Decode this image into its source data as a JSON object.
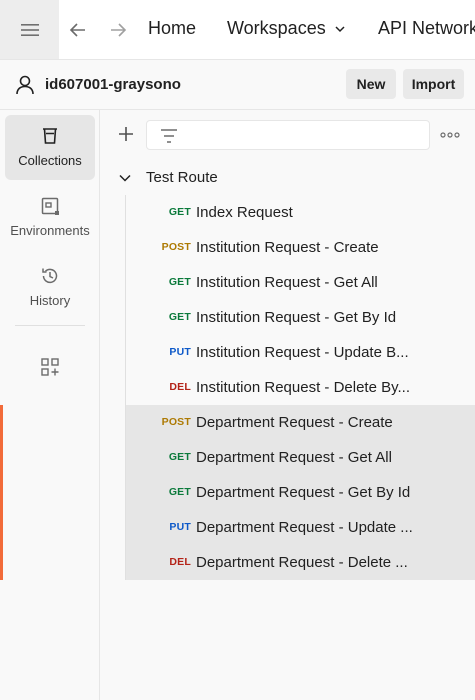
{
  "topbar": {
    "home_label": "Home",
    "workspaces_label": "Workspaces",
    "api_network_label": "API Network"
  },
  "workspace": {
    "name": "id607001-graysono",
    "new_label": "New",
    "import_label": "Import"
  },
  "rail": {
    "items": [
      {
        "label": "Collections",
        "icon": "collections-icon",
        "active": true
      },
      {
        "label": "Environments",
        "icon": "environments-icon",
        "active": false
      },
      {
        "label": "History",
        "icon": "history-icon",
        "active": false
      }
    ]
  },
  "filter": {
    "placeholder": ""
  },
  "collection": {
    "name": "Test Route",
    "requests": [
      {
        "method": "GET",
        "name": "Index Request"
      },
      {
        "method": "POST",
        "name": "Institution Request - Create"
      },
      {
        "method": "GET",
        "name": "Institution Request - Get All"
      },
      {
        "method": "GET",
        "name": "Institution Request - Get By Id"
      },
      {
        "method": "PUT",
        "name": "Institution Request - Update B..."
      },
      {
        "method": "DEL",
        "name": "Institution Request - Delete By..."
      },
      {
        "method": "POST",
        "name": "Department Request - Create"
      },
      {
        "method": "GET",
        "name": "Department Request - Get All"
      },
      {
        "method": "GET",
        "name": "Department Request - Get By Id"
      },
      {
        "method": "PUT",
        "name": "Department Request - Update ..."
      },
      {
        "method": "DEL",
        "name": "Department Request - Delete ..."
      }
    ]
  },
  "colors": {
    "accent": "#f26b3a",
    "get": "#0b7a3b",
    "post": "#ad7a03",
    "put": "#0d59c9",
    "del": "#b42318"
  }
}
